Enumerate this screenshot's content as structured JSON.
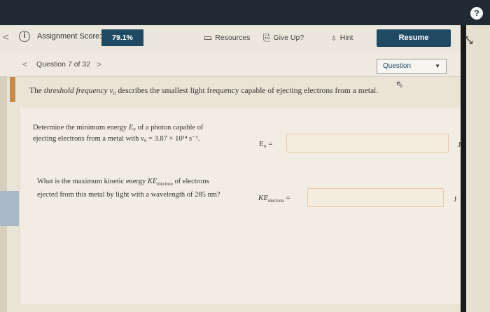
{
  "toolbar": {
    "score_label": "Assignment Score:",
    "score_value": "79.1%",
    "resources": "Resources",
    "give_up": "Give Up?",
    "hint": "Hint",
    "resume": "Resume"
  },
  "icons": {
    "help": "?",
    "info": "i",
    "back": "<",
    "prev": "<",
    "next": ">",
    "expand": "⤡",
    "resources": "▭",
    "give_up": "⎘",
    "hint": "♁"
  },
  "nav": {
    "counter": "Question 7 of 32",
    "select_value": "Question"
  },
  "intro": {
    "pre": "The ",
    "term": "threshold frequency",
    "sym": "ν₀",
    "post": " describes the smallest light frequency capable of ejecting electrons from a metal."
  },
  "q1": {
    "line1_pre": "Determine the minimum energy ",
    "line1_sym": "E₀",
    "line1_post": " of a photon capable of",
    "line2": "ejecting electrons from a metal with ν₀ = 3.87 × 10¹⁴ s⁻¹.",
    "label": "E₀ =",
    "unit": "J"
  },
  "q2": {
    "line1_pre": "What is the maximum kinetic energy ",
    "line1_sym": "KE",
    "line1_sub": "electron",
    "line1_post": " of electrons",
    "line2": "ejected from this metal by light with a wavelength of 285 nm?",
    "label_sym": "KE",
    "label_sub": "electron",
    "label_eq": " =",
    "unit": "J"
  },
  "colors": {
    "accent": "#204a64",
    "topbar": "#1f2a35",
    "input_border": "#e8c9a8"
  }
}
